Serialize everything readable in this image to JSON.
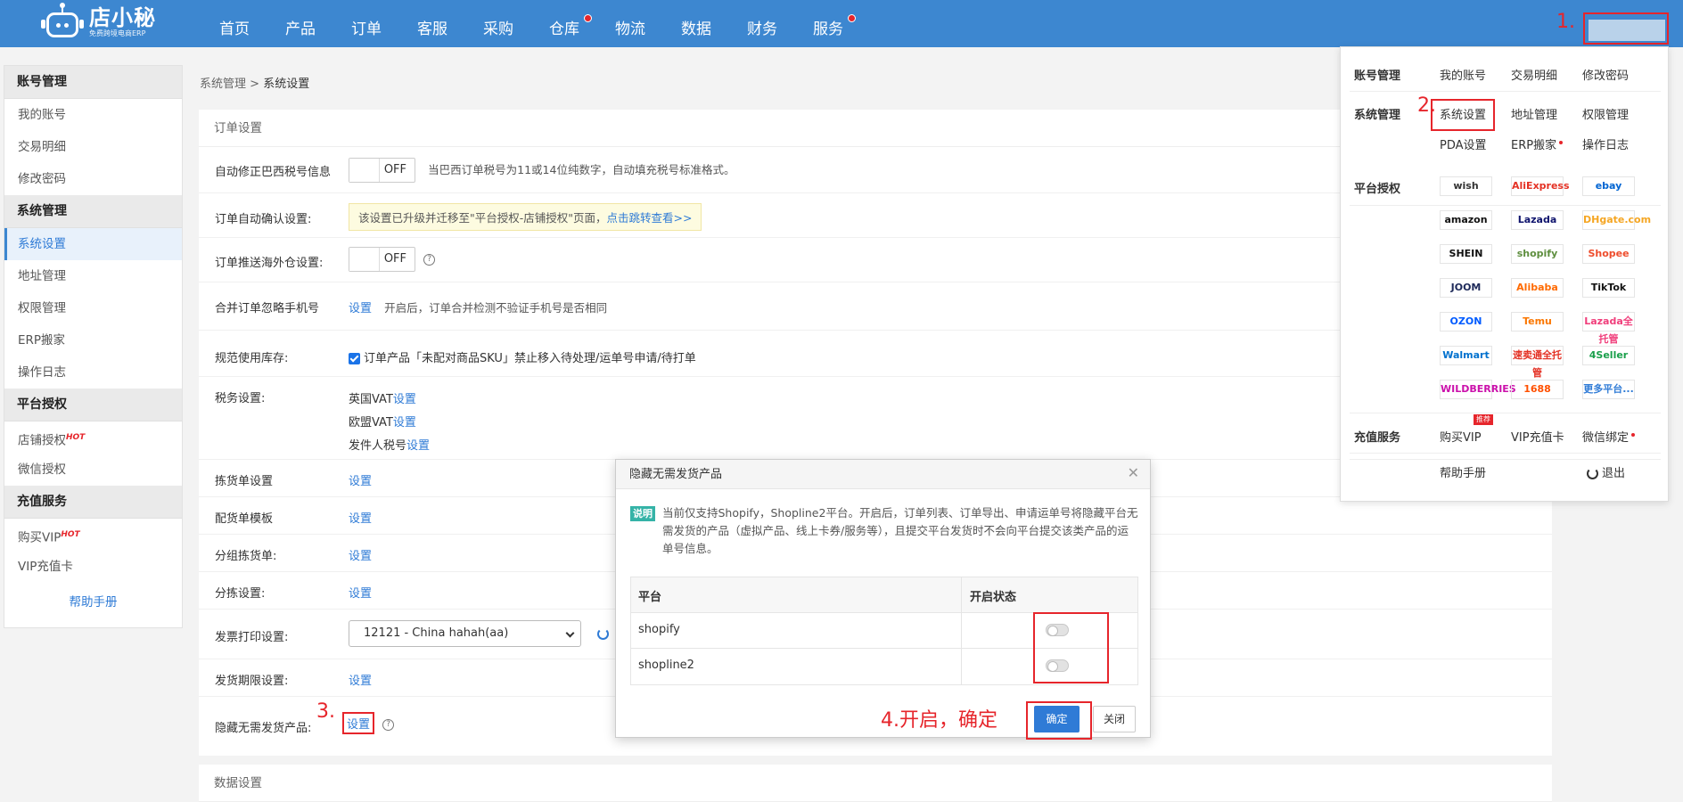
{
  "logo": {
    "name": "店小秘",
    "subtitle": "免费跨境电商ERP"
  },
  "nav": [
    "首页",
    "产品",
    "订单",
    "客服",
    "采购",
    "仓库",
    "物流",
    "数据",
    "财务",
    "服务"
  ],
  "annotations": {
    "a1": "1.",
    "a2": "2.",
    "a3": "3.",
    "a4": "4.开启，确定"
  },
  "sidebar": {
    "groups": [
      {
        "title": "账号管理",
        "items": [
          "我的账号",
          "交易明细",
          "修改密码"
        ]
      },
      {
        "title": "系统管理",
        "items": [
          "系统设置",
          "地址管理",
          "权限管理",
          "ERP搬家",
          "操作日志"
        ]
      },
      {
        "title": "平台授权",
        "items": [
          "店铺授权",
          "微信授权"
        ]
      },
      {
        "title": "充值服务",
        "items": [
          "购买VIP",
          "VIP充值卡"
        ]
      }
    ],
    "hot": "HOT",
    "help": "帮助手册"
  },
  "breadcrumb": {
    "parent": "系统管理",
    "sep": ">",
    "current": "系统设置"
  },
  "order_settings": {
    "title": "订单设置",
    "rows": {
      "brazil": {
        "label": "自动修正巴西税号信息",
        "toggle": "OFF",
        "hint": "当巴西订单税号为11或14位纯数字，自动填充税号标准格式。"
      },
      "auto_confirm": {
        "label": "订单自动确认设置:",
        "notice": "该设置已升级并迁移至\"平台授权-店铺授权\"页面，",
        "notice_link": "点击跳转查看>>"
      },
      "overseas": {
        "label": "订单推送海外仓设置:",
        "toggle": "OFF"
      },
      "merge": {
        "label": "合并订单忽略手机号",
        "link": "设置",
        "hint": "开启后，订单合并检测不验证手机号是否相同"
      },
      "stock": {
        "label": "规范使用库存:",
        "text": "订单产品「未配对商品SKU」禁止移入待处理/运单号申请/待打单"
      },
      "tax": {
        "label": "税务设置:",
        "items": [
          {
            "name": "英国VAT",
            "link": "设置"
          },
          {
            "name": "欧盟VAT",
            "link": "设置"
          },
          {
            "name": "发件人税号",
            "link": "设置"
          }
        ]
      },
      "picking": {
        "label": "拣货单设置",
        "link": "设置"
      },
      "packing": {
        "label": "配货单模板",
        "link": "设置"
      },
      "group_pick": {
        "label": "分组拣货单:",
        "link": "设置"
      },
      "sorting": {
        "label": "分拣设置:",
        "link": "设置"
      },
      "invoice": {
        "label": "发票打印设置:",
        "selected": "12121 - China hahah(aa)"
      },
      "deadline": {
        "label": "发货期限设置:",
        "link": "设置"
      },
      "hide": {
        "label": "隐藏无需发货产品:",
        "link": "设置"
      }
    }
  },
  "data_settings": {
    "title": "数据设置"
  },
  "dropdown": {
    "account": {
      "label": "账号管理",
      "links": [
        "我的账号",
        "交易明细",
        "修改密码"
      ]
    },
    "system": {
      "label": "系统管理",
      "links": [
        "系统设置",
        "地址管理",
        "权限管理",
        "PDA设置",
        "ERP搬家",
        "操作日志"
      ]
    },
    "platform": {
      "label": "平台授权",
      "items": [
        {
          "name": "wish",
          "color": "#333333"
        },
        {
          "name": "AliExpress",
          "color": "#e43225"
        },
        {
          "name": "ebay",
          "color": "#0064d2"
        },
        {
          "name": "amazon",
          "color": "#111111"
        },
        {
          "name": "Lazada",
          "color": "#0f146d"
        },
        {
          "name": "DHgate.com",
          "color": "#f5a623"
        },
        {
          "name": "SHEIN",
          "color": "#111111"
        },
        {
          "name": "shopify",
          "color": "#5e8e3e"
        },
        {
          "name": "Shopee",
          "color": "#ee4d2d"
        },
        {
          "name": "JOOM",
          "color": "#1e2a5a"
        },
        {
          "name": "Alibaba",
          "color": "#ff6a00"
        },
        {
          "name": "TikTok",
          "color": "#111111"
        },
        {
          "name": "OZON",
          "color": "#005bff"
        },
        {
          "name": "Temu",
          "color": "#fb7701"
        },
        {
          "name": "Lazada全托管",
          "color": "#f03e7b"
        },
        {
          "name": "Walmart",
          "color": "#0071ce"
        },
        {
          "name": "速卖通全托管",
          "color": "#e43225"
        },
        {
          "name": "4Seller",
          "color": "#1a9f4b"
        },
        {
          "name": "WILDBERRIES",
          "color": "#cb11ab"
        },
        {
          "name": "1688",
          "color": "#ff5000"
        },
        {
          "name": "更多平台...",
          "color": "#2f7bd6"
        }
      ]
    },
    "recharge": {
      "label": "充值服务",
      "links": [
        "购买VIP",
        "VIP充值卡",
        "微信绑定"
      ],
      "badge": "推荐"
    },
    "help": "帮助手册",
    "logout": "退出"
  },
  "modal": {
    "title": "隐藏无需发货产品",
    "tag": "说明",
    "desc": "当前仅支持Shopify，Shopline2平台。开启后，订单列表、订单导出、申请运单号将隐藏平台无需发货的产品（虚拟产品、线上卡券/服务等），且提交平台发货时不会向平台提交该类产品的运单号信息。",
    "columns": [
      "平台",
      "开启状态"
    ],
    "rows": [
      "shopify",
      "shopline2"
    ],
    "confirm": "确定",
    "close": "关闭"
  },
  "colors": {
    "nav": "#3d87d0",
    "accent": "#2f7bd6",
    "annotation": "#e6252b"
  }
}
